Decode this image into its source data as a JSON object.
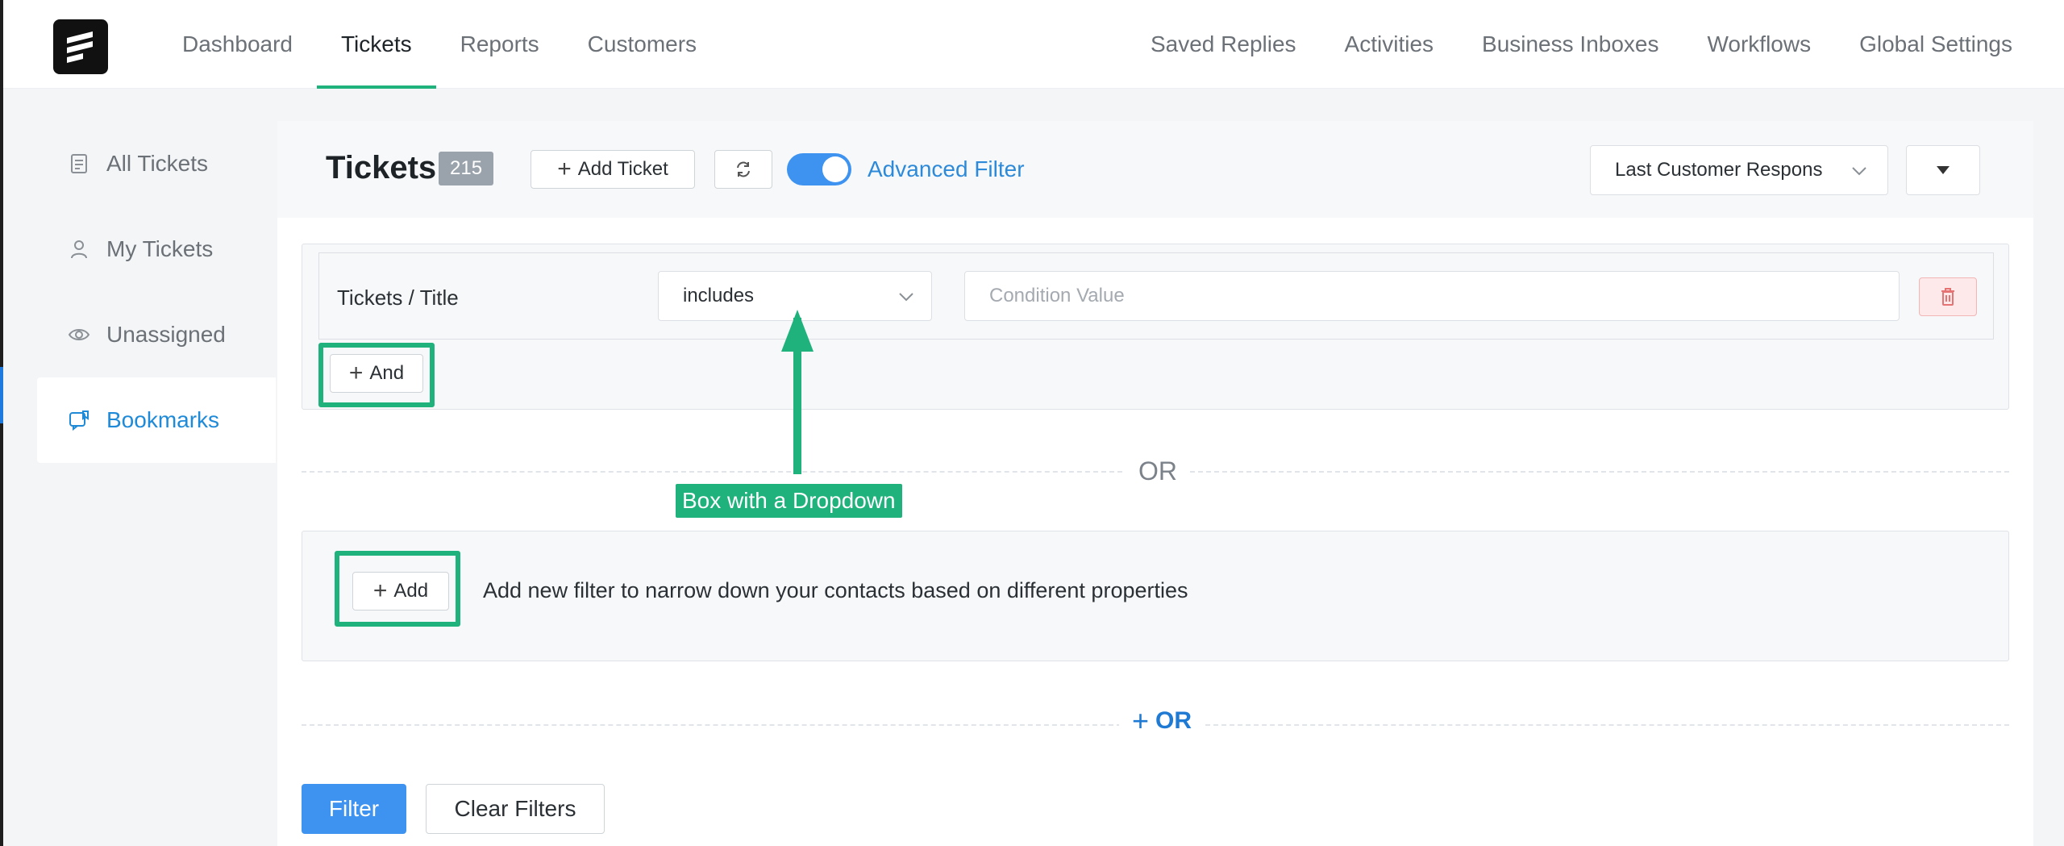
{
  "nav": {
    "left": [
      "Dashboard",
      "Tickets",
      "Reports",
      "Customers"
    ],
    "right": [
      "Saved Replies",
      "Activities",
      "Business Inboxes",
      "Workflows",
      "Global Settings"
    ],
    "active": "Tickets"
  },
  "sidebar": {
    "items": [
      {
        "label": "All Tickets",
        "icon": "document-icon"
      },
      {
        "label": "My Tickets",
        "icon": "user-icon"
      },
      {
        "label": "Unassigned",
        "icon": "eye-icon"
      },
      {
        "label": "Bookmarks",
        "icon": "bookmark-icon",
        "active": true
      }
    ]
  },
  "header": {
    "title": "Tickets",
    "count": "215",
    "add_ticket_label": "Add Ticket",
    "advanced_filter_label": "Advanced Filter",
    "advanced_filter_on": true,
    "sort_by": "Last Customer Respons"
  },
  "filter_group_1": {
    "field": "Tickets / Title",
    "operator": "includes",
    "value_placeholder": "Condition Value",
    "and_label": "And"
  },
  "or_divider_label": "OR",
  "annotation": {
    "label": "Box with a Dropdown",
    "color": "#1fb27c"
  },
  "filter_group_2": {
    "add_label": "Add",
    "hint": "Add new filter to narrow down your contacts based on different properties"
  },
  "add_or_label": "OR",
  "actions": {
    "filter_label": "Filter",
    "clear_label": "Clear Filters"
  },
  "colors": {
    "accent_green": "#1fb27c",
    "primary_blue": "#3e93f0",
    "link_blue": "#2d8ad9"
  }
}
